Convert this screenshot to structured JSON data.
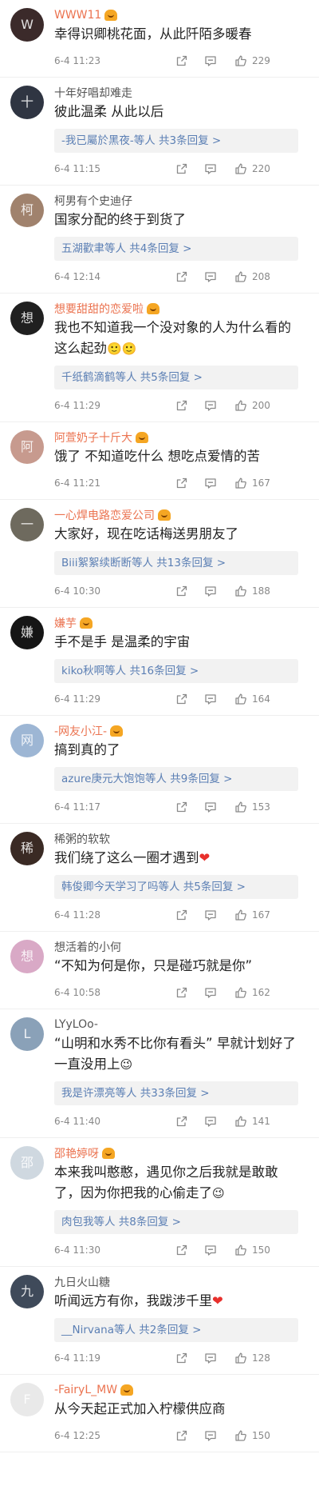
{
  "comments": [
    {
      "user": "WWW11",
      "user_style": "orange",
      "vip": true,
      "text": "幸得识卿桃花面，从此阡陌多暖春",
      "time": "6-4 11:23",
      "likes": "229",
      "avatar_color": "#3b2a2a"
    },
    {
      "user": "十年好唱却难走",
      "user_style": "gray",
      "vip": false,
      "text": "彼此温柔 从此以后",
      "replies": "-我已屬於黑夜-等人 共3条回复 >",
      "time": "6-4 11:15",
      "likes": "220",
      "avatar_color": "#2f3542"
    },
    {
      "user": "柯男有个史迪仔",
      "user_style": "gray",
      "vip": false,
      "text": "国家分配的终于到货了",
      "replies": "五湖歡聿等人 共4条回复 >",
      "time": "6-4 12:14",
      "likes": "208",
      "avatar_color": "#a0826d"
    },
    {
      "user": "想要甜甜的恋爱啦",
      "user_style": "orange",
      "vip": true,
      "text": "我也不知道我一个没对象的人为什么看的这么起劲",
      "emoji": "🙂🙂",
      "replies": "千纸鹤滴鹤等人 共5条回复 >",
      "time": "6-4 11:29",
      "likes": "200",
      "avatar_color": "#202020"
    },
    {
      "user": "阿萱奶子十斤大",
      "user_style": "orange",
      "vip": true,
      "text": "饿了 不知道吃什么 想吃点爱情的苦",
      "time": "6-4 11:21",
      "likes": "167",
      "avatar_color": "#c79a8e"
    },
    {
      "user": "一心焊电路恋爱公司",
      "user_style": "orange",
      "vip": true,
      "text": "大家好，现在吃话梅送男朋友了",
      "replies": "Biii絮絮续断断等人 共13条回复 >",
      "time": "6-4 10:30",
      "likes": "188",
      "avatar_color": "#6e6a5e"
    },
    {
      "user": "嫌芋",
      "user_style": "orange",
      "vip": true,
      "text": "手不是手 是温柔的宇宙",
      "replies": "kiko秋啊等人 共16条回复 >",
      "time": "6-4 11:29",
      "likes": "164",
      "avatar_color": "#151515"
    },
    {
      "user": "-网友小江-",
      "user_style": "orange",
      "vip": true,
      "text": "搞到真的了",
      "replies": "azure庚元大饱饱等人 共9条回复 >",
      "time": "6-4 11:17",
      "likes": "153",
      "avatar_color": "#9db6d4"
    },
    {
      "user": "稀粥的软软",
      "user_style": "gray",
      "vip": false,
      "text": "我们绕了这么一圈才遇到",
      "heart": "❤",
      "replies": "韩俊卿今天学习了吗等人 共5条回复 >",
      "time": "6-4 11:28",
      "likes": "167",
      "avatar_color": "#3a2a24"
    },
    {
      "user": "想活着的小何",
      "user_style": "gray",
      "vip": false,
      "text": "“不知为何是你，只是碰巧就是你”",
      "time": "6-4 10:58",
      "likes": "162",
      "avatar_color": "#d9a9c6"
    },
    {
      "user": "LYyLOo-",
      "user_style": "gray",
      "vip": false,
      "text": "“山明和水秀不比你有看头” 早就计划好了一直没用上",
      "emoji": "😉",
      "replies": "我是许漂亮等人 共33条回复 >",
      "time": "6-4 11:40",
      "likes": "141",
      "avatar_color": "#8aa1b8"
    },
    {
      "user": "邵艳婷呀",
      "user_style": "orange",
      "vip": true,
      "text": "本来我叫憨憨，遇见你之后我就是敢敢了，因为你把我的心偷走了",
      "emoji": "😉",
      "replies": "肉包我等人 共8条回复 >",
      "time": "6-4 11:30",
      "likes": "150",
      "avatar_color": "#cfd8e0"
    },
    {
      "user": "九日火山糖",
      "user_style": "gray",
      "vip": false,
      "text": "听闻远方有你，我跋涉千里",
      "heart": "❤",
      "replies": "__Nirvana等人 共2条回复 >",
      "time": "6-4 11:19",
      "likes": "128",
      "avatar_color": "#3f4a5a"
    },
    {
      "user": "-FairyL_MW",
      "user_style": "orange",
      "vip": true,
      "text": "从今天起正式加入柠檬供应商",
      "time": "6-4 12:25",
      "likes": "150",
      "avatar_color": "#e9e9e9"
    }
  ]
}
